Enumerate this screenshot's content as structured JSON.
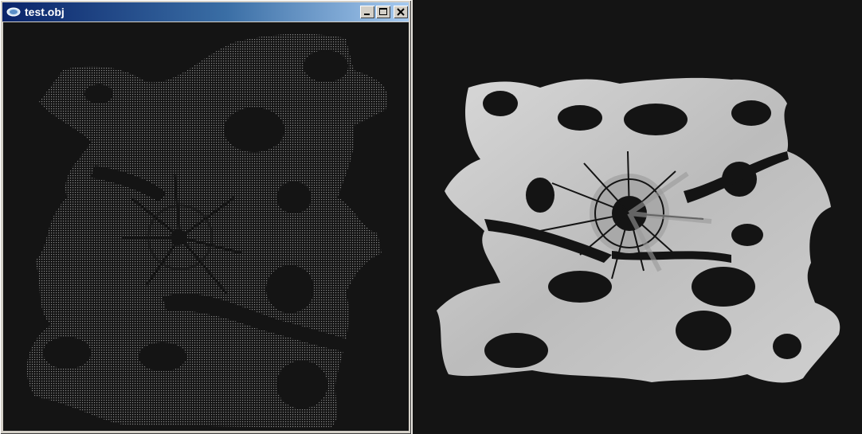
{
  "window": {
    "title": "test.obj",
    "icon": "app-icon",
    "buttons": [
      "minimize-icon",
      "maximize-icon",
      "close-icon"
    ]
  },
  "viewports": {
    "left": {
      "style": "point-cloud",
      "background": "#141414",
      "point_color": "#7a7a7a"
    },
    "right": {
      "style": "shaded-mesh",
      "background": "#141414",
      "surface_color": "#c4c4c4"
    }
  }
}
